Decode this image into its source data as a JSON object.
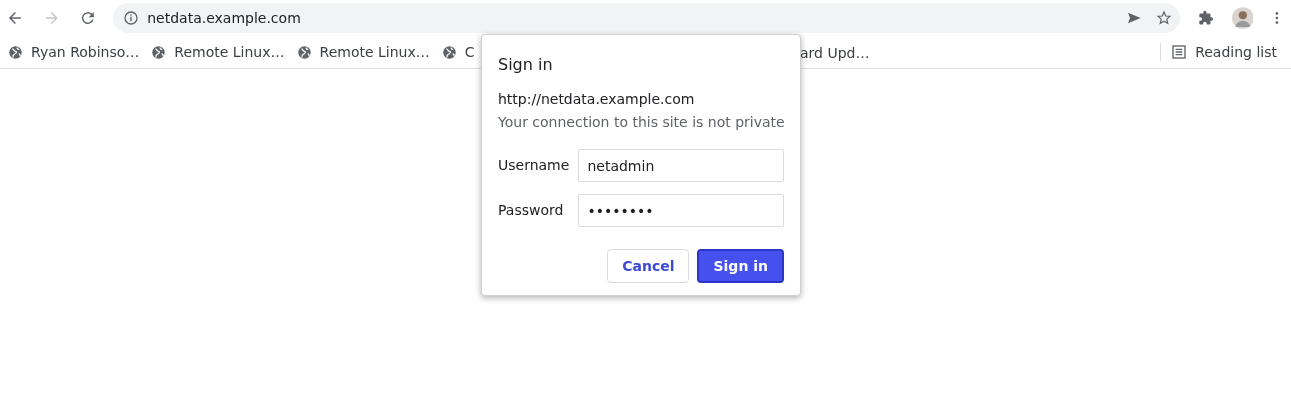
{
  "address_bar": {
    "url": "netdata.example.com"
  },
  "bookmarks": [
    {
      "label": "Ryan Robinso…"
    },
    {
      "label": "Remote Linux…"
    },
    {
      "label": "Remote Linux…"
    },
    {
      "label": "C"
    }
  ],
  "bookmark_fragment": "ard Upd…",
  "reading_list": "Reading list",
  "dialog": {
    "title": "Sign in",
    "origin": "http://netdata.example.com",
    "warning": "Your connection to this site is not private",
    "fields": [
      {
        "label": "Username",
        "value": "netadmin"
      },
      {
        "label": "Password",
        "value": "••••••••"
      }
    ],
    "buttons": [
      {
        "label": "Cancel",
        "kind": "secondary"
      },
      {
        "label": "Sign in",
        "kind": "primary"
      }
    ]
  }
}
